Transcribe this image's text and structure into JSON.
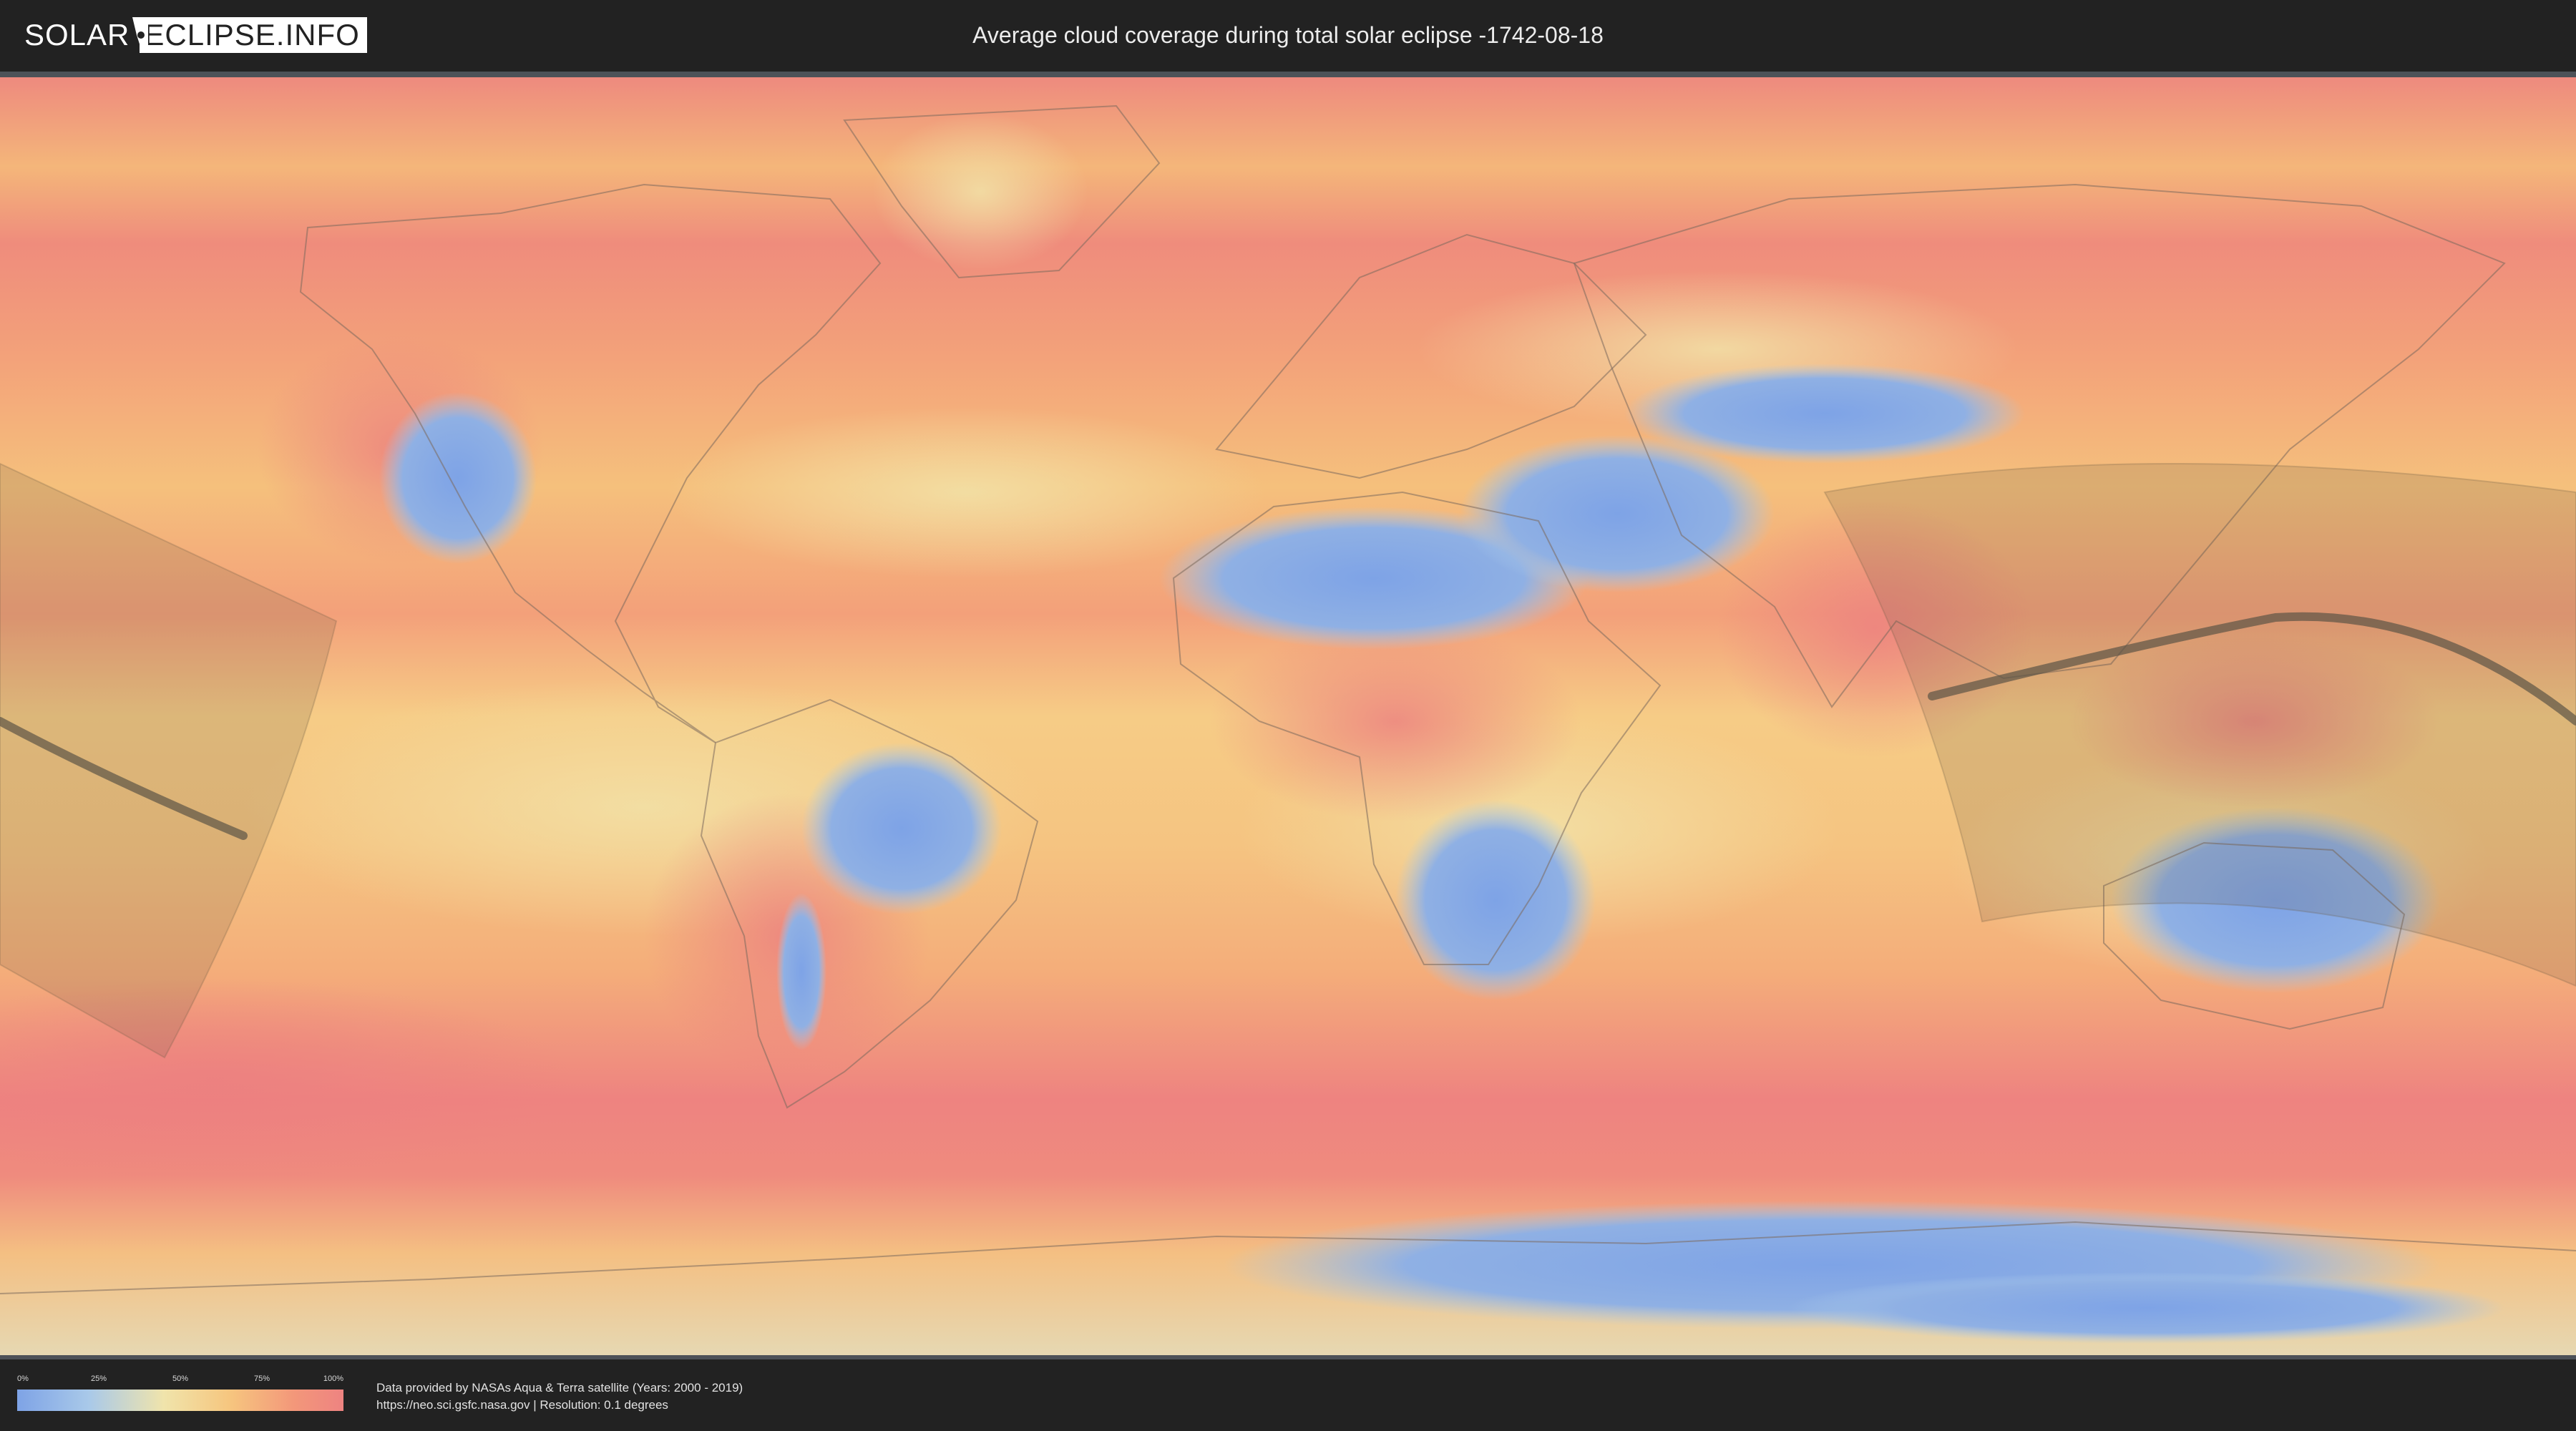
{
  "header": {
    "logo_left": "SOLAR",
    "logo_right": "ECLIPSE.INFO",
    "title": "Average cloud coverage during total solar eclipse -1742-08-18"
  },
  "legend": {
    "ticks": [
      "0%",
      "25%",
      "50%",
      "75%",
      "100%"
    ],
    "color_scale": [
      "#7ea3e6",
      "#a9c9e9",
      "#f0e4ab",
      "#f6c67f",
      "#f3977a",
      "#ee8381"
    ]
  },
  "credits": {
    "line1": "Data provided by NASAs Aqua & Terra satellite (Years: 2000 - 2019)",
    "line2": "https://neo.sci.gsfc.nasa.gov | Resolution: 0.1 degrees"
  },
  "colors": {
    "background": "#222222",
    "cloud_low": "#7ea3e6",
    "cloud_mid": "#f0e4ab",
    "cloud_high": "#ee8381",
    "eclipse_path": "#6b5a44"
  }
}
